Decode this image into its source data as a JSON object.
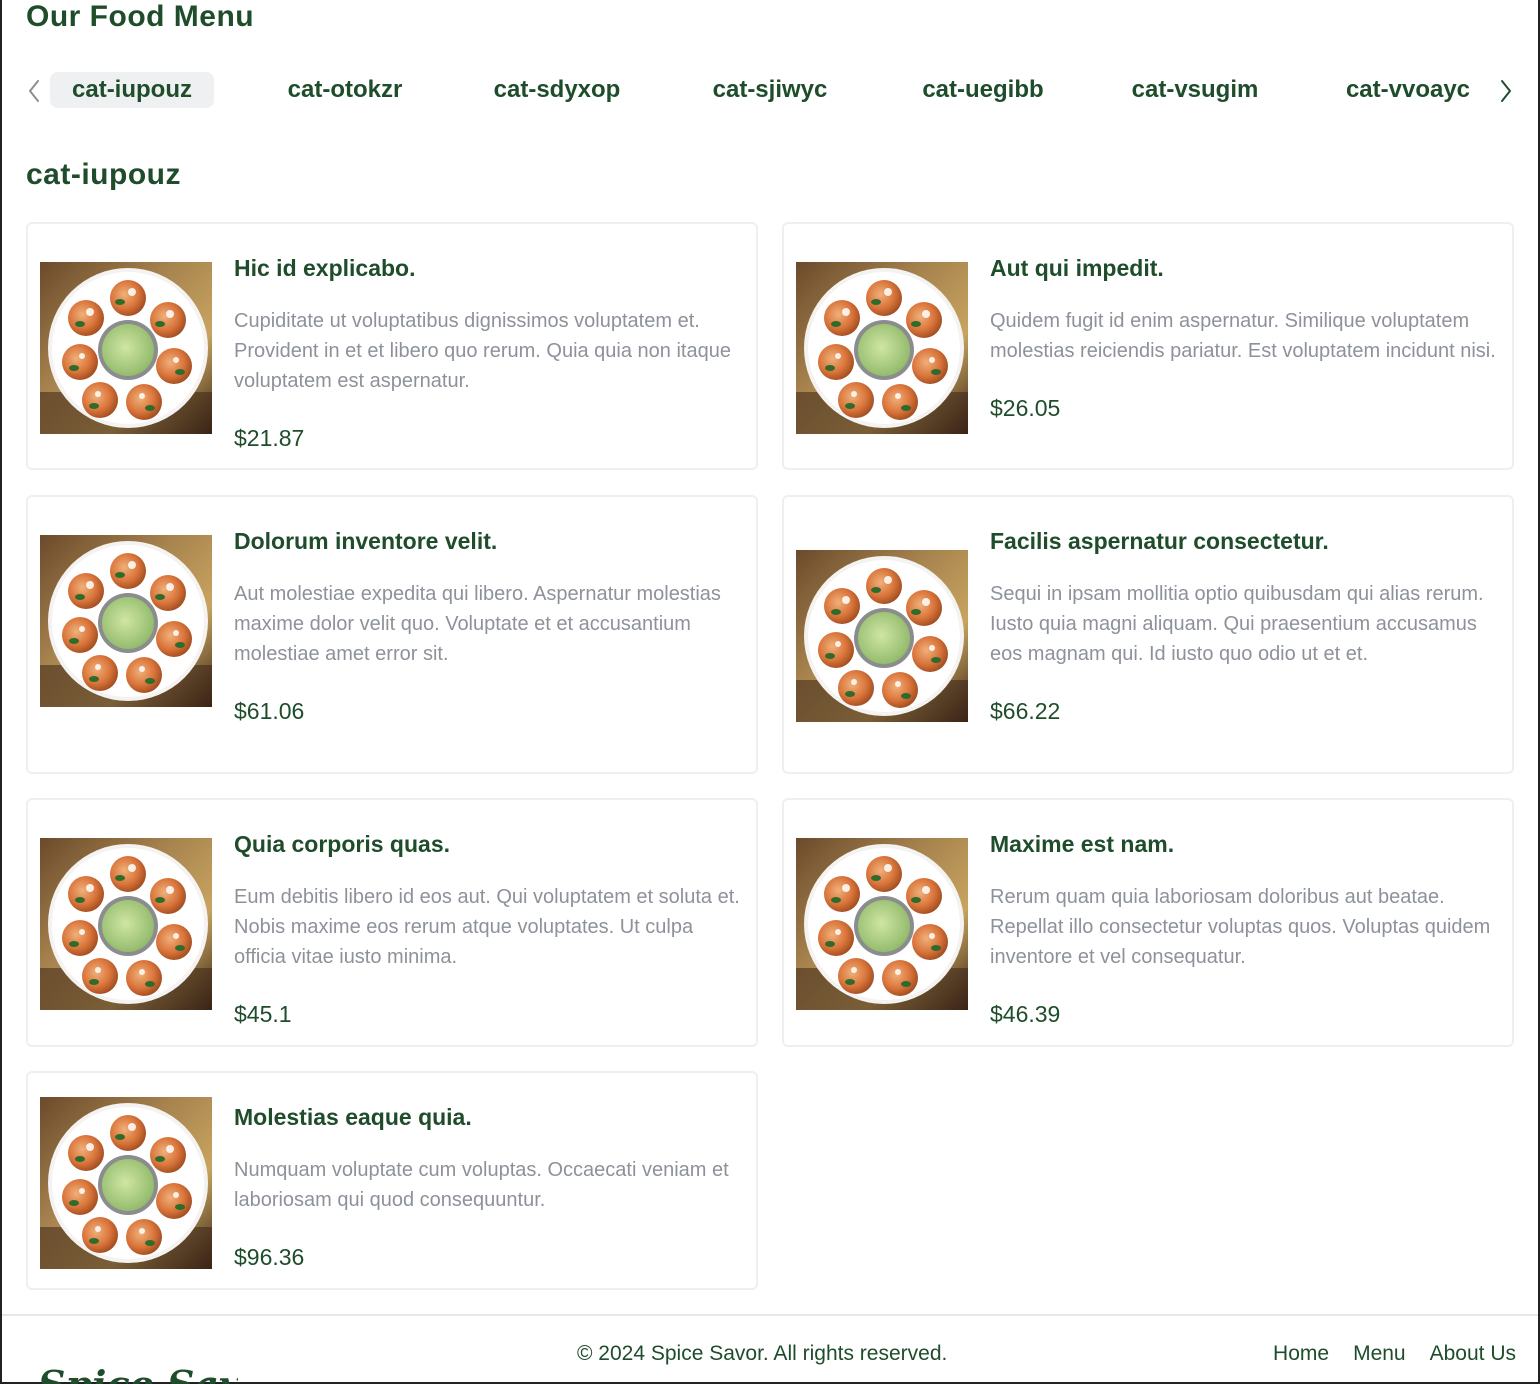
{
  "page": {
    "title": "Our Food Menu"
  },
  "categories": {
    "tabs": [
      "cat-iupouz",
      "cat-otokzr",
      "cat-sdyxop",
      "cat-sjiwyc",
      "cat-uegibb",
      "cat-vsugim",
      "cat-vvoayc"
    ],
    "active": "cat-iupouz"
  },
  "section": {
    "title": "cat-iupouz"
  },
  "items": [
    {
      "name": "Hic id explicabo.",
      "description": "Cupiditate ut voluptatibus dignissimos voluptatem et. Provident in et et libero quo rerum. Quia quia non itaque voluptatem est aspernatur.",
      "price": "$21.87"
    },
    {
      "name": "Aut qui impedit.",
      "description": "Quidem fugit id enim aspernatur. Similique voluptatem molestias reiciendis pariatur. Est voluptatem incidunt nisi.",
      "price": "$26.05"
    },
    {
      "name": "Dolorum inventore velit.",
      "description": "Aut molestiae expedita qui libero. Aspernatur molestias maxime dolor velit quo. Voluptate et et accusantium molestiae amet error sit.",
      "price": "$61.06"
    },
    {
      "name": "Facilis aspernatur consectetur.",
      "description": "Sequi in ipsam mollitia optio quibusdam qui alias rerum. Iusto quia magni aliquam. Qui praesentium accusamus eos magnam qui. Id iusto quo odio ut et et.",
      "price": "$66.22"
    },
    {
      "name": "Quia corporis quas.",
      "description": "Eum debitis libero id eos aut. Qui voluptatem et soluta et. Nobis maxime eos rerum atque voluptates. Ut culpa officia vitae iusto minima.",
      "price": "$45.1"
    },
    {
      "name": "Maxime est nam.",
      "description": "Rerum quam quia laboriosam doloribus aut beatae. Repellat illo consectetur voluptas quos. Voluptas quidem inventore et vel consequatur.",
      "price": "$46.39"
    },
    {
      "name": "Molestias eaque quia.",
      "description": "Numquam voluptate cum voluptas. Occaecati veniam et laboriosam qui quod consequuntur.",
      "price": "$96.36"
    }
  ],
  "footer": {
    "brand": "Spice Savor",
    "copyright": "© 2024 Spice Savor. All rights reserved.",
    "links": [
      "Home",
      "Menu",
      "About Us"
    ]
  },
  "colors": {
    "primary": "#1f4d2b",
    "muted_text": "#8d929a",
    "active_tab_bg": "#eef0f2",
    "card_border": "#eeeff1"
  },
  "icons": {
    "prev": "chevron-left-icon",
    "next": "chevron-right-icon",
    "food": "food-plate-image"
  }
}
